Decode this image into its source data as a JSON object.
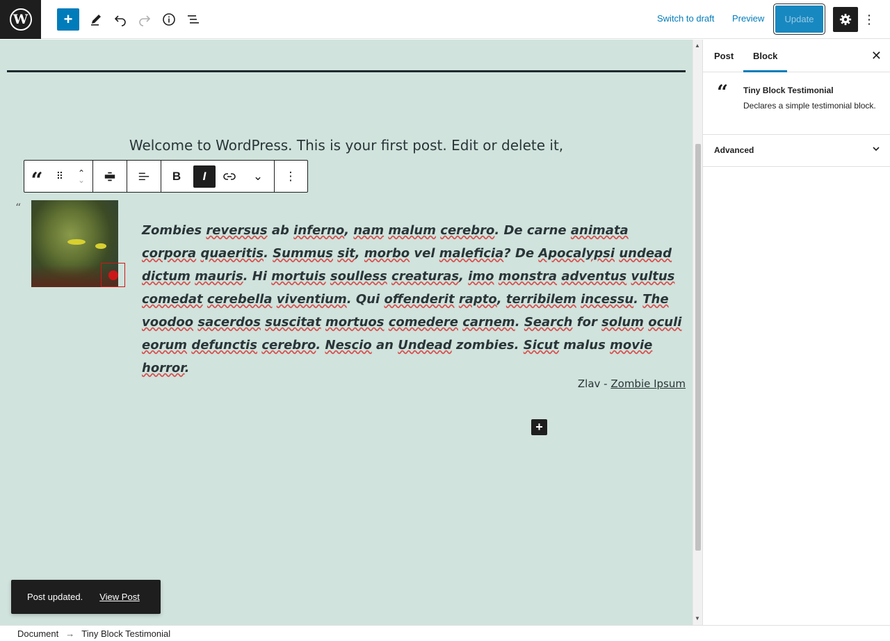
{
  "header": {
    "logo": "W",
    "add_icon": "+",
    "tools_icon": "pencil-icon",
    "undo_icon": "undo-icon",
    "redo_icon": "redo-icon",
    "info_icon": "info-icon",
    "list_view_icon": "list-view-icon",
    "switch_to_draft": "Switch to draft",
    "preview": "Preview",
    "update": "Update",
    "settings_icon": "gear-icon",
    "more_icon": "⋮"
  },
  "editor": {
    "welcome_text": "Welcome to WordPress. This is your first post. Edit or delete it,",
    "block_toolbar": {
      "block_icon": "“",
      "drag_icon": "⠿",
      "up_icon": "⌃",
      "down_icon": "⌄",
      "align_icon": "▬",
      "text_align_icon": "≡",
      "bold": "B",
      "italic": "I",
      "link_icon": "link-icon",
      "more_rich_icon": "⌄",
      "options_icon": "⋮"
    },
    "quote_mark": "“",
    "testimonial_words": [
      {
        "t": "Zombies ",
        "u": false
      },
      {
        "t": "reversus",
        "u": true
      },
      {
        "t": " ab ",
        "u": false
      },
      {
        "t": "inferno",
        "u": true
      },
      {
        "t": ", ",
        "u": false
      },
      {
        "t": "nam",
        "u": true
      },
      {
        "t": " ",
        "u": false
      },
      {
        "t": "malum",
        "u": true
      },
      {
        "t": " ",
        "u": false
      },
      {
        "t": "cerebro",
        "u": true
      },
      {
        "t": ". De carne ",
        "u": false
      },
      {
        "t": "animata",
        "u": true
      },
      {
        "t": " ",
        "u": false
      },
      {
        "t": "corpora",
        "u": true
      },
      {
        "t": " ",
        "u": false
      },
      {
        "t": "quaeritis",
        "u": true
      },
      {
        "t": ". ",
        "u": false
      },
      {
        "t": "Summus",
        "u": true
      },
      {
        "t": " ",
        "u": false
      },
      {
        "t": "sit",
        "u": true
      },
      {
        "t": ", ",
        "u": false
      },
      {
        "t": "morbo",
        "u": true
      },
      {
        "t": " vel ",
        "u": false
      },
      {
        "t": "maleficia",
        "u": true
      },
      {
        "t": "? De ",
        "u": false
      },
      {
        "t": "Apocalypsi",
        "u": true
      },
      {
        "t": " ",
        "u": false
      },
      {
        "t": "undead",
        "u": true
      },
      {
        "t": " ",
        "u": false
      },
      {
        "t": "dictum",
        "u": true
      },
      {
        "t": " ",
        "u": false
      },
      {
        "t": "mauris",
        "u": true
      },
      {
        "t": ". Hi ",
        "u": false
      },
      {
        "t": "mortuis",
        "u": true
      },
      {
        "t": " ",
        "u": false
      },
      {
        "t": "soulless",
        "u": true
      },
      {
        "t": " ",
        "u": false
      },
      {
        "t": "creaturas",
        "u": true
      },
      {
        "t": ", ",
        "u": false
      },
      {
        "t": "imo",
        "u": true
      },
      {
        "t": " ",
        "u": false
      },
      {
        "t": "monstra",
        "u": true
      },
      {
        "t": " ",
        "u": false
      },
      {
        "t": "adventus",
        "u": true
      },
      {
        "t": " ",
        "u": false
      },
      {
        "t": "vultus",
        "u": true
      },
      {
        "t": " ",
        "u": false
      },
      {
        "t": "comedat",
        "u": true
      },
      {
        "t": " ",
        "u": false
      },
      {
        "t": "cerebella",
        "u": true
      },
      {
        "t": " ",
        "u": false
      },
      {
        "t": "viventium",
        "u": true
      },
      {
        "t": ". Qui ",
        "u": false
      },
      {
        "t": "offenderit",
        "u": true
      },
      {
        "t": " ",
        "u": false
      },
      {
        "t": "rapto",
        "u": true
      },
      {
        "t": ", ",
        "u": false
      },
      {
        "t": "terribilem",
        "u": true
      },
      {
        "t": " ",
        "u": false
      },
      {
        "t": "incessu",
        "u": true
      },
      {
        "t": ". ",
        "u": false
      },
      {
        "t": "The",
        "u": true
      },
      {
        "t": " ",
        "u": false
      },
      {
        "t": "voodoo",
        "u": true
      },
      {
        "t": " ",
        "u": false
      },
      {
        "t": "sacerdos",
        "u": true
      },
      {
        "t": " ",
        "u": false
      },
      {
        "t": "suscitat",
        "u": true
      },
      {
        "t": " ",
        "u": false
      },
      {
        "t": "mortuos",
        "u": true
      },
      {
        "t": " ",
        "u": false
      },
      {
        "t": "comedere",
        "u": true
      },
      {
        "t": " ",
        "u": false
      },
      {
        "t": "carnem",
        "u": true
      },
      {
        "t": ". ",
        "u": false
      },
      {
        "t": "Search",
        "u": true
      },
      {
        "t": " for ",
        "u": false
      },
      {
        "t": "solum",
        "u": true
      },
      {
        "t": " ",
        "u": false
      },
      {
        "t": "oculi",
        "u": true
      },
      {
        "t": " ",
        "u": false
      },
      {
        "t": "eorum",
        "u": true
      },
      {
        "t": " ",
        "u": false
      },
      {
        "t": "defunctis",
        "u": true
      },
      {
        "t": " ",
        "u": false
      },
      {
        "t": "cerebro",
        "u": true
      },
      {
        "t": ". ",
        "u": false
      },
      {
        "t": "Nescio",
        "u": true
      },
      {
        "t": " an ",
        "u": false
      },
      {
        "t": "Undead",
        "u": true
      },
      {
        "t": " zombies. ",
        "u": false
      },
      {
        "t": "Sicut",
        "u": true
      },
      {
        "t": " malus ",
        "u": false
      },
      {
        "t": "movie",
        "u": true
      },
      {
        "t": " ",
        "u": false
      },
      {
        "t": "horror",
        "u": true
      },
      {
        "t": ".",
        "u": false
      }
    ],
    "author_name": "Zlav - ",
    "author_link": "Zombie Ipsum",
    "inserter_icon": "+"
  },
  "snackbar": {
    "message": "Post updated.",
    "action": "View Post"
  },
  "sidebar": {
    "tabs": [
      "Post",
      "Block"
    ],
    "active_tab": "Block",
    "close_icon": "✕",
    "block_icon": "“",
    "block_title": "Tiny Block Testimonial",
    "block_description": "Declares a simple testimonial block.",
    "advanced_label": "Advanced",
    "advanced_chevron": "⌄"
  },
  "footer": {
    "breadcrumb": [
      "Document",
      "Tiny Block Testimonial"
    ],
    "separator": "→"
  },
  "colors": {
    "accent": "#007cba",
    "canvas_bg": "#d0e3dc",
    "dark": "#1e1e1e",
    "spell_error": "#d94f4f"
  }
}
